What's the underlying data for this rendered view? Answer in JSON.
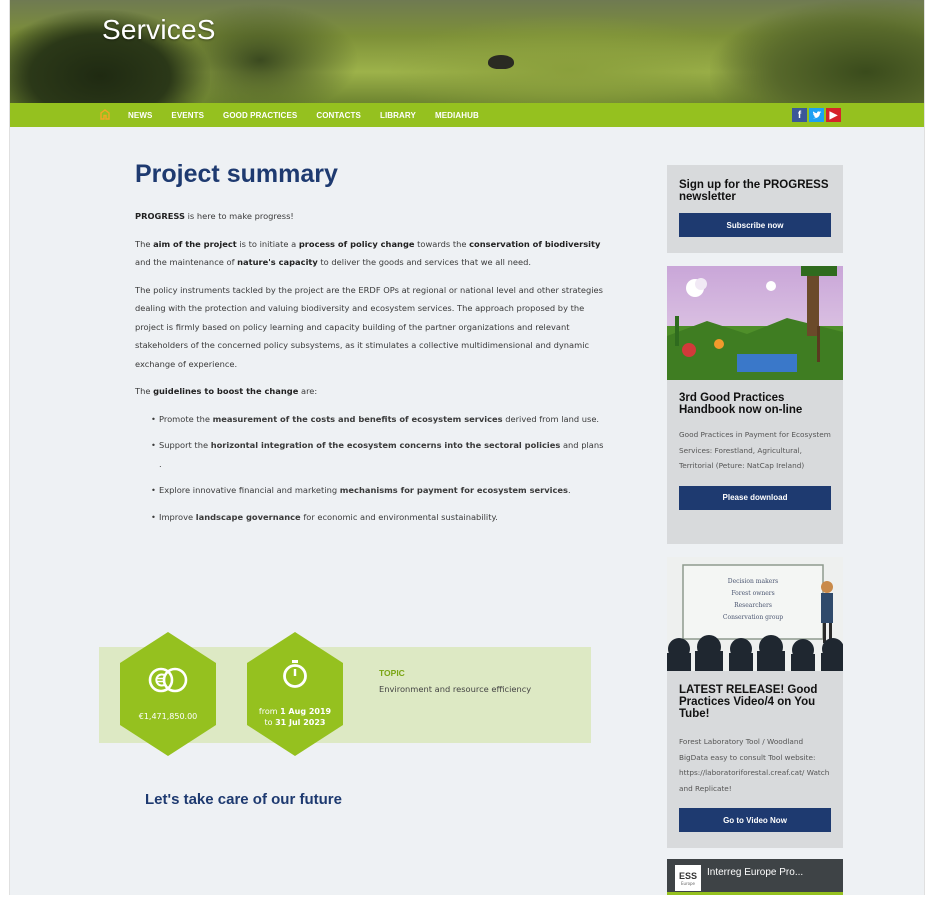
{
  "hero": {
    "title": "ServiceS"
  },
  "nav": {
    "items": [
      "NEWS",
      "EVENTS",
      "GOOD PRACTICES",
      "CONTACTS",
      "LIBRARY",
      "MEDIAHUB"
    ],
    "social": {
      "facebook": "f",
      "twitter": "t",
      "youtube": "▶"
    }
  },
  "main": {
    "title": "Project summary",
    "intro_bold": "PROGRESS",
    "intro_rest": " is here to make progress!",
    "aim": {
      "p1": "The ",
      "b1": "aim of the project",
      "p2": " is to initiate a ",
      "b2": "process of policy change",
      "p3": " towards the ",
      "b3": "conservation of biodiversity",
      "p4": " and the maintenance of ",
      "b4": "nature's capacity",
      "p5": " to deliver the goods and services that we all need."
    },
    "policy_text": "The policy instruments tackled by the project are the ERDF OPs at regional or national level and other strategies dealing with the protection and valuing biodiversity and ecosystem services. The approach proposed by the project is firmly based on policy learning and capacity building of the partner organizations and relevant stakeholders of the concerned policy subsystems, as it stimulates a collective multidimensional and dynamic exchange of experience.",
    "guidelines": {
      "p1": "The ",
      "b1": "guidelines to boost the change",
      "p2": " are:"
    },
    "bullets": [
      {
        "pre": "Promote the ",
        "bold": "measurement of the costs and benefits of ecosystem services",
        "post": " derived from land use."
      },
      {
        "pre": "Support the ",
        "bold": "horizontal integration of the ecosystem concerns into the sectoral policies",
        "post": " and plans ."
      },
      {
        "pre": "Explore innovative financial and marketing ",
        "bold": "mechanisms for payment for ecosystem services",
        "post": "."
      },
      {
        "pre": "Improve ",
        "bold": "landscape governance",
        "post": " for economic and environmental sustainability."
      }
    ],
    "stats": {
      "budget": "€1,471,850.00",
      "from_pre": "from ",
      "from_date": "1 Aug 2019",
      "to_pre": "to ",
      "to_date": "31 Jul 2023",
      "topic_label": "TOPIC",
      "topic_value": "Environment and resource efficiency"
    },
    "future": "Let's take care of our future"
  },
  "sidebar": {
    "newsletter": {
      "title": "Sign up for the PROGRESS newsletter",
      "button": "Subscribe now"
    },
    "handbook": {
      "title": "3rd Good Practices Handbook now on-line",
      "text": "Good Practices in Payment for Ecosystem Services: Forestland, Agricultural, Territorial (Peture: NatCap Ireland)",
      "button": "Please download"
    },
    "video": {
      "board_lines": [
        "Decision makers",
        "Forest owners",
        "Researchers",
        "Conservation group"
      ],
      "title": "LATEST RELEASE! Good Practices Video/4 on You Tube!",
      "text": "Forest Laboratory Tool / Woodland BigData easy to consult Tool website: https://laboratoriforestal.creaf.cat/ Watch and Replicate!",
      "button": "Go to Video Now"
    },
    "youtube": {
      "title": "Interreg Europe Pro...",
      "logo": "ESS",
      "logo_sub": "Europe"
    }
  },
  "colors": {
    "green": "#95c11f",
    "navy": "#1e3a70",
    "bg": "#eef1f4"
  }
}
